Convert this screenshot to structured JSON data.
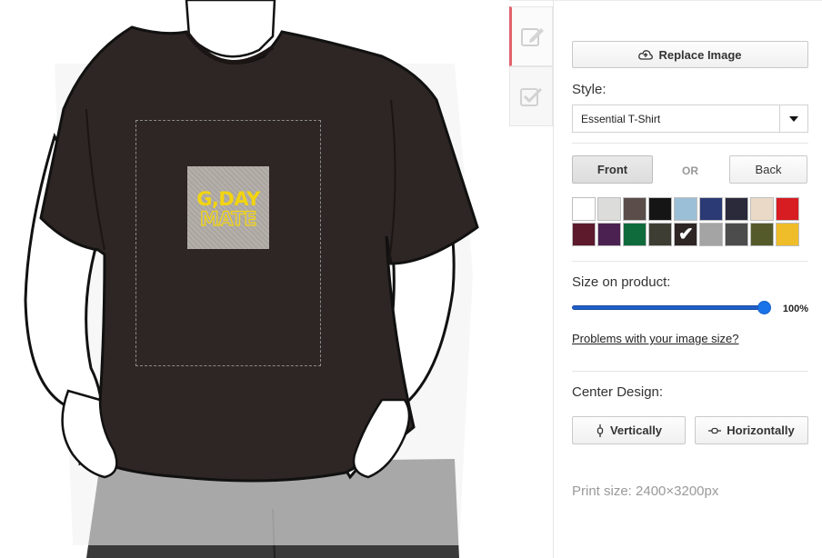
{
  "panel": {
    "replace_image_label": "Replace Image",
    "style_label": "Style:",
    "style_value": "Essential T-Shirt",
    "front_label": "Front",
    "or_label": "OR",
    "back_label": "Back",
    "size_label": "Size on product:",
    "size_value": "100%",
    "size_fraction": 1.0,
    "problems_link": "Problems with your image size?",
    "center_label": "Center Design:",
    "vertically_label": "Vertically",
    "horizontally_label": "Horizontally",
    "print_size": "Print size: 2400×3200px"
  },
  "design": {
    "line1": "G,DAY",
    "line2": "MATE"
  },
  "colors": {
    "tee": "#2e2624",
    "accent": "#e2626b",
    "slider": "#1a73e8",
    "design_text": "#f2d410"
  },
  "icons": {
    "edit_tab": "edit-icon",
    "done_tab": "checkbox-icon",
    "replace": "cloud-upload-icon",
    "dropdown": "caret-down-icon"
  },
  "swatches": [
    {
      "color": "#ffffff",
      "selected": false
    },
    {
      "color": "#dcdcda",
      "selected": false
    },
    {
      "color": "#5a4d4a",
      "selected": false
    },
    {
      "color": "#151515",
      "selected": false
    },
    {
      "color": "#9bbfd6",
      "selected": false
    },
    {
      "color": "#2b3a74",
      "selected": false
    },
    {
      "color": "#2b2a3b",
      "selected": false
    },
    {
      "color": "#ead9c6",
      "selected": false
    },
    {
      "color": "#d71c22",
      "selected": false
    },
    {
      "color": "#5c1a2c",
      "selected": false
    },
    {
      "color": "#4a2150",
      "selected": false
    },
    {
      "color": "#0f6a3c",
      "selected": false
    },
    {
      "color": "#3e3d33",
      "selected": false
    },
    {
      "color": "#2e2624",
      "selected": true
    },
    {
      "color": "#a4a4a4",
      "selected": false
    },
    {
      "color": "#4c4c4c",
      "selected": false
    },
    {
      "color": "#555a2a",
      "selected": false
    },
    {
      "color": "#f0bd2a",
      "selected": false
    }
  ]
}
